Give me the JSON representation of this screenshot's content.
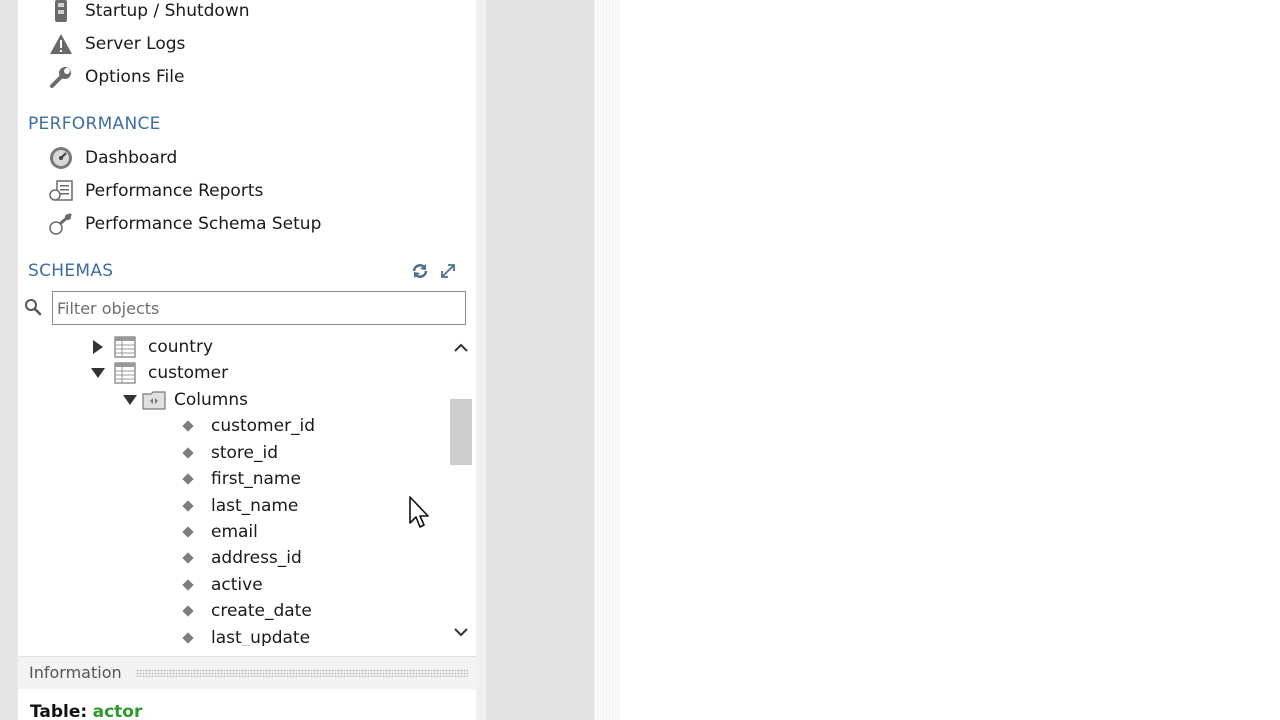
{
  "management": {
    "items": [
      {
        "label": "Startup / Shutdown",
        "icon": "startup-shutdown-icon"
      },
      {
        "label": "Server Logs",
        "icon": "warning-icon"
      },
      {
        "label": "Options File",
        "icon": "wrench-icon"
      }
    ]
  },
  "performance": {
    "title": "PERFORMANCE",
    "items": [
      {
        "label": "Dashboard",
        "icon": "dashboard-gauge-icon"
      },
      {
        "label": "Performance Reports",
        "icon": "reports-icon"
      },
      {
        "label": "Performance Schema Setup",
        "icon": "schema-setup-icon"
      }
    ]
  },
  "schemas": {
    "title": "SCHEMAS",
    "filter_placeholder": "Filter objects",
    "tree": {
      "country": "country",
      "customer": "customer",
      "columns_folder": "Columns",
      "columns": [
        "customer_id",
        "store_id",
        "first_name",
        "last_name",
        "email",
        "address_id",
        "active",
        "create_date",
        "last_update"
      ]
    }
  },
  "information": {
    "title": "Information",
    "table_label": "Table:",
    "table_value": "actor"
  },
  "colors": {
    "section_title": "#3d6ea3",
    "table_value": "#2e9a2e"
  }
}
